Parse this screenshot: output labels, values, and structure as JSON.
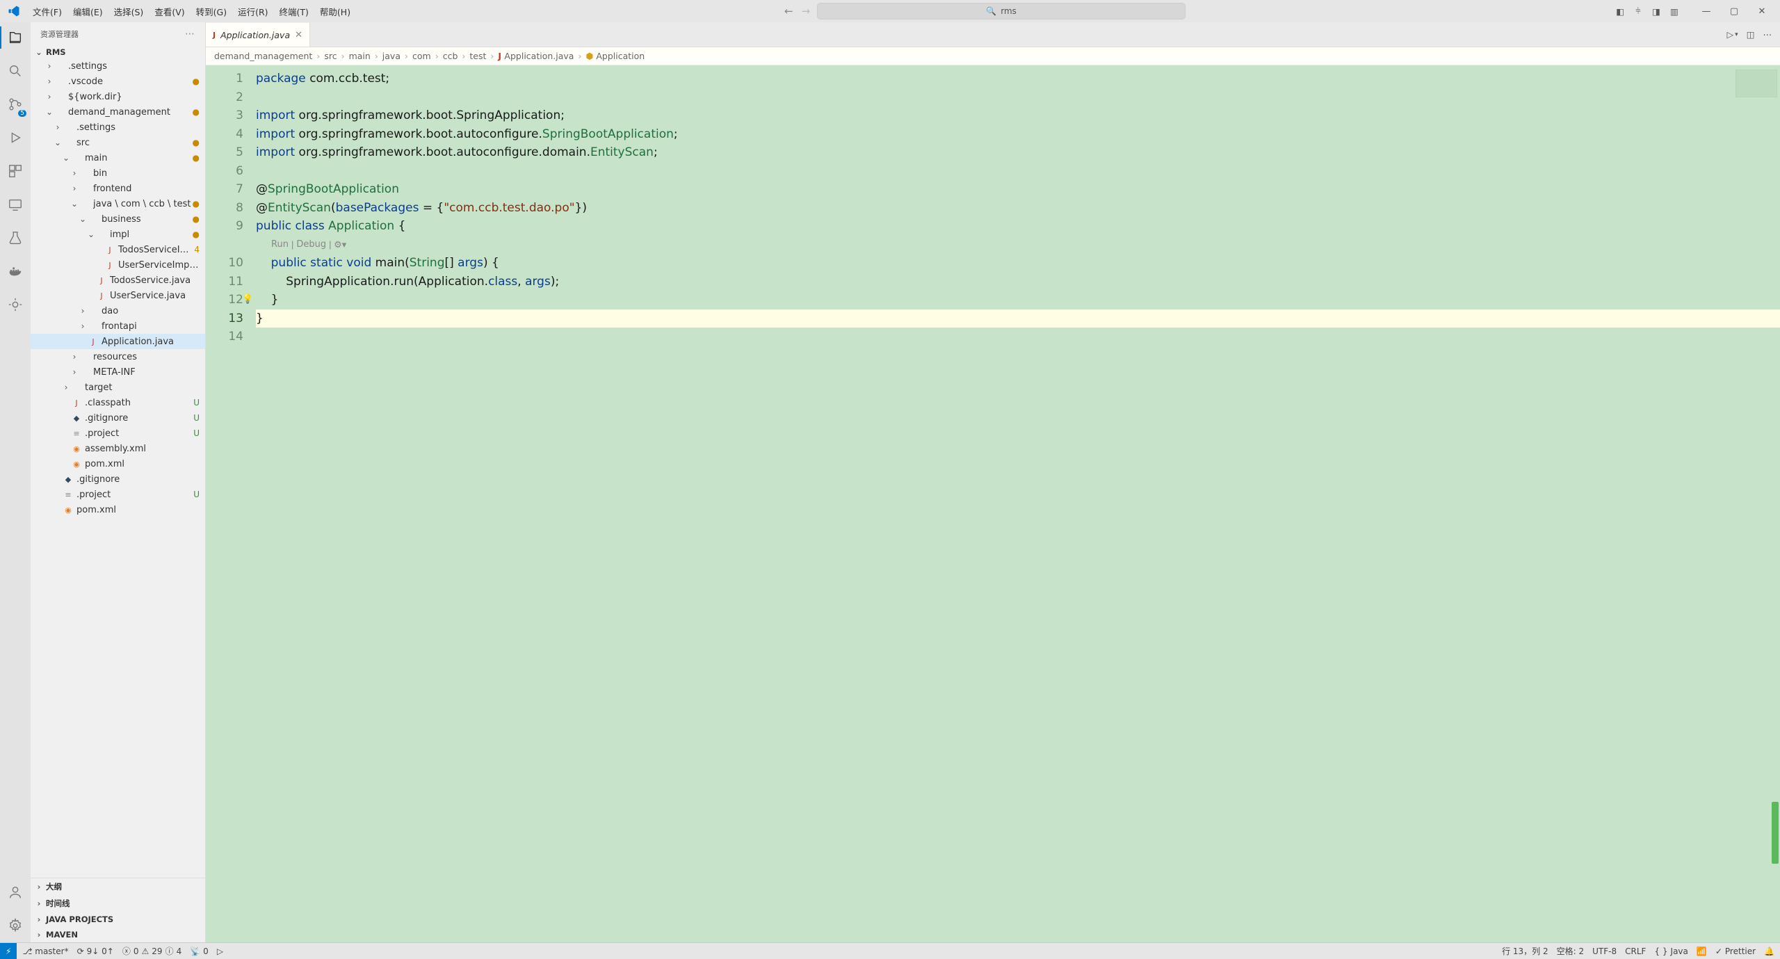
{
  "menu": {
    "file": "文件(F)",
    "edit": "编辑(E)",
    "select": "选择(S)",
    "view": "查看(V)",
    "goto": "转到(G)",
    "run": "运行(R)",
    "terminal": "终端(T)",
    "help": "帮助(H)"
  },
  "search": {
    "placeholder": "rms"
  },
  "sidebar": {
    "title": "资源管理器",
    "root": "RMS",
    "sections": {
      "outline": "大纲",
      "timeline": "时间线",
      "java_projects": "JAVA PROJECTS",
      "maven": "MAVEN"
    }
  },
  "tree": [
    {
      "l": ".settings",
      "d": 1,
      "t": ">",
      "i": "",
      "c": ""
    },
    {
      "l": ".vscode",
      "d": 1,
      "t": ">",
      "b": "●",
      "i": "",
      "c": "#b58900"
    },
    {
      "l": "${work.dir}",
      "d": 1,
      "t": ">",
      "i": "",
      "c": ""
    },
    {
      "l": "demand_management",
      "d": 1,
      "t": "v",
      "b": "●",
      "i": "",
      "c": "#b58900"
    },
    {
      "l": ".settings",
      "d": 2,
      "t": ">",
      "i": "",
      "c": ""
    },
    {
      "l": "src",
      "d": 2,
      "t": "v",
      "b": "●",
      "i": "",
      "c": "#b58900"
    },
    {
      "l": "main",
      "d": 3,
      "t": "v",
      "b": "●",
      "i": "",
      "c": "#b58900"
    },
    {
      "l": "bin",
      "d": 4,
      "t": ">",
      "i": "",
      "c": ""
    },
    {
      "l": "frontend",
      "d": 4,
      "t": ">",
      "i": "",
      "c": ""
    },
    {
      "l": "java \\ com \\ ccb \\ test",
      "d": 4,
      "t": "v",
      "b": "●",
      "i": "",
      "c": "#b58900"
    },
    {
      "l": "business",
      "d": 5,
      "t": "v",
      "b": "●",
      "i": "",
      "c": "#b58900"
    },
    {
      "l": "impl",
      "d": 6,
      "t": "v",
      "b": "●",
      "i": "",
      "c": "#b58900"
    },
    {
      "l": "TodosServiceImpl.java",
      "d": 7,
      "t": "",
      "b": "4",
      "i": "J",
      "c": "#c0392b"
    },
    {
      "l": "UserServiceImpl.java",
      "d": 7,
      "t": "",
      "i": "J",
      "c": "#c0392b"
    },
    {
      "l": "TodosService.java",
      "d": 6,
      "t": "",
      "i": "J",
      "c": "#c0392b"
    },
    {
      "l": "UserService.java",
      "d": 6,
      "t": "",
      "i": "J",
      "c": "#c0392b"
    },
    {
      "l": "dao",
      "d": 5,
      "t": ">",
      "i": "",
      "c": ""
    },
    {
      "l": "frontapi",
      "d": 5,
      "t": ">",
      "i": "",
      "c": ""
    },
    {
      "l": "Application.java",
      "d": 5,
      "t": "",
      "i": "J",
      "c": "#c0392b",
      "sel": true
    },
    {
      "l": "resources",
      "d": 4,
      "t": ">",
      "i": "",
      "c": ""
    },
    {
      "l": "META-INF",
      "d": 4,
      "t": ">",
      "i": "",
      "c": ""
    },
    {
      "l": "target",
      "d": 3,
      "t": ">",
      "i": "",
      "c": ""
    },
    {
      "l": ".classpath",
      "d": 3,
      "t": "",
      "b": "U",
      "bu": true,
      "i": "J",
      "c": "#c0392b"
    },
    {
      "l": ".gitignore",
      "d": 3,
      "t": "",
      "b": "U",
      "bu": true,
      "i": "◆",
      "c": "#34495e"
    },
    {
      "l": ".project",
      "d": 3,
      "t": "",
      "b": "U",
      "bu": true,
      "i": "≡",
      "c": "#888"
    },
    {
      "l": "assembly.xml",
      "d": 3,
      "t": "",
      "i": "◉",
      "c": "#e67e22"
    },
    {
      "l": "pom.xml",
      "d": 3,
      "t": "",
      "i": "◉",
      "c": "#e67e22"
    },
    {
      "l": ".gitignore",
      "d": 2,
      "t": "",
      "i": "◆",
      "c": "#34495e"
    },
    {
      "l": ".project",
      "d": 2,
      "t": "",
      "b": "U",
      "bu": true,
      "i": "≡",
      "c": "#888"
    },
    {
      "l": "pom.xml",
      "d": 2,
      "t": "",
      "i": "◉",
      "c": "#e67e22"
    }
  ],
  "tab": {
    "label": "Application.java"
  },
  "breadcrumb": [
    "demand_management",
    "src",
    "main",
    "java",
    "com",
    "ccb",
    "test",
    "Application.java",
    "Application"
  ],
  "codelens": {
    "run": "Run",
    "debug": "Debug"
  },
  "code": {
    "line1": {
      "kw": "package ",
      "body": "com.ccb.test;"
    },
    "line3": {
      "kw": "import ",
      "body": "org.springframework.boot.SpringApplication;"
    },
    "line4": {
      "kw": "import ",
      "b1": "org.springframework.boot.autoconfigure.",
      "t": "SpringBootApplication",
      "b2": ";"
    },
    "line5": {
      "kw": "import ",
      "b1": "org.springframework.boot.autoconfigure.domain.",
      "t": "EntityScan",
      "b2": ";"
    },
    "line7": {
      "at": "@",
      "ann": "SpringBootApplication"
    },
    "line8": {
      "at": "@",
      "ann": "EntityScan",
      "p1": "(",
      "var": "basePackages",
      "eq": " = {",
      "str": "\"com.ccb.test.dao.po\"",
      "p2": "})"
    },
    "line9": {
      "kw": "public class ",
      "t": "Application ",
      "b": "{"
    },
    "line10": {
      "sp": "    ",
      "kw": "public static void ",
      "m": "main",
      "p1": "(",
      "t": "String",
      "ar": "[] ",
      "var": "args",
      "p2": ") {"
    },
    "line11": {
      "sp": "        ",
      "b1": "SpringApplication.",
      "m": "run",
      "p1": "(Application.",
      "kw": "class",
      "c": ", ",
      "var": "args",
      "p2": ");"
    },
    "line12": {
      "sp": "    ",
      "b": "}"
    },
    "line13": {
      "b": "}"
    }
  },
  "status": {
    "branch": "master*",
    "sync": "9↓ 0↑",
    "err": "0",
    "warn": "29",
    "info": "4",
    "ports": "0",
    "cursor": "行 13，列 2",
    "spaces": "空格: 2",
    "encoding": "UTF-8",
    "eol": "CRLF",
    "lang": "Java",
    "prettier": "Prettier"
  }
}
